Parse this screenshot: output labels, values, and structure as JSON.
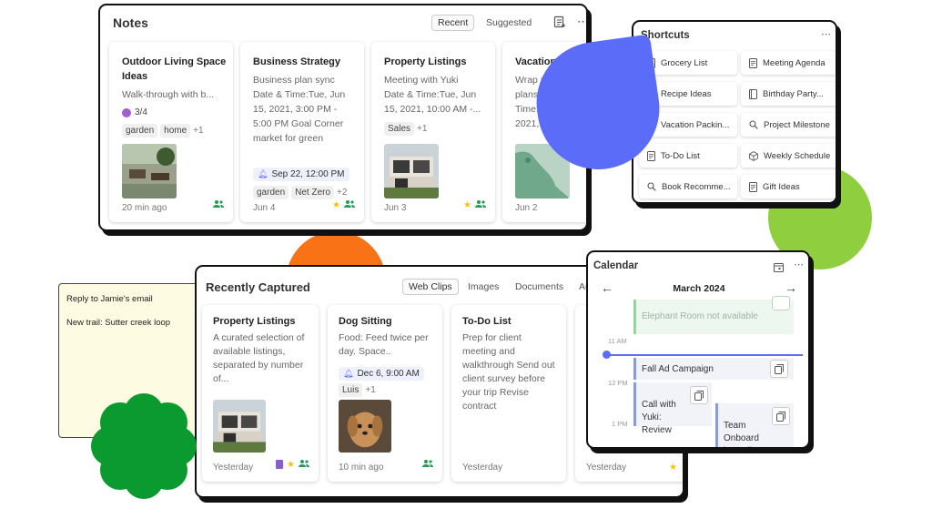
{
  "notes": {
    "title": "Notes",
    "tabs": [
      "Recent",
      "Suggested"
    ],
    "cards": [
      {
        "title": "Outdoor Living Space Ideas",
        "text": "Walk-through with b...",
        "checklist": "3/4",
        "tags": [
          "garden",
          "home"
        ],
        "more": "+1",
        "time": "20 min ago"
      },
      {
        "title": "Business Strategy",
        "text": "Business plan sync\nDate & Time:Tue, Jun\n15, 2021, 3:00 PM -\n5:00 PM Goal Corner\nmarket for green",
        "reminder": "Sep 22, 12:00 PM",
        "tags": [
          "garden",
          "Net Zero"
        ],
        "more": "+2",
        "time": "Jun 4"
      },
      {
        "title": "Property Listings",
        "text": "Meeting with Yuki\nDate & Time:Tue, Jun\n15, 2021, 10:00 AM -...",
        "tags": [
          "Sales"
        ],
        "more": "+1",
        "time": "Jun 3"
      },
      {
        "title": "Vacation Itinera",
        "text": "Wrap up vacati\nplans Date &\nTime:S\n2021,",
        "time": "Jun 2"
      }
    ]
  },
  "shortcuts": {
    "title": "Shortcuts",
    "items": [
      {
        "label": "Grocery List",
        "icon": "note-icon"
      },
      {
        "label": "Meeting Agenda",
        "icon": "note-icon"
      },
      {
        "label": "Recipe Ideas",
        "icon": "note-icon"
      },
      {
        "label": "Birthday Party...",
        "icon": "notebook-icon"
      },
      {
        "label": "Vacation Packin...",
        "icon": "note-icon"
      },
      {
        "label": "Project Milestone",
        "icon": "search-icon"
      },
      {
        "label": "To-Do List",
        "icon": "note-icon"
      },
      {
        "label": "Weekly Schedule",
        "icon": "cube-icon"
      },
      {
        "label": "Book Recomme...",
        "icon": "search-icon"
      },
      {
        "label": "Gift Ideas",
        "icon": "note-icon"
      }
    ]
  },
  "sticky": {
    "lines": [
      "Reply to Jamie's email",
      "New trail: Sutter creek loop"
    ]
  },
  "recent": {
    "title": "Recently Captured",
    "tabs": [
      "Web Clips",
      "Images",
      "Documents",
      "Au"
    ],
    "cards": [
      {
        "title": "Property Listings",
        "text": "A curated selection of\navailable listings,\nseparated by number\nof...",
        "time": "Yesterday"
      },
      {
        "title": "Dog Sitting",
        "text": "Food: Feed twice per\nday. Space..",
        "reminder": "Dec 6, 9:00 AM",
        "tags": [
          "Luis"
        ],
        "more": "+1",
        "time": "10 min ago"
      },
      {
        "title": "To-Do List",
        "text": "Prep for client\nmeeting and\nwalkthrough Send out\nclient survey before\nyour trip Revise\ncontract",
        "time": "Yesterday"
      },
      {
        "title": "",
        "text": "",
        "time": "Yesterday"
      }
    ]
  },
  "calendar": {
    "title": "Calendar",
    "month": "March 2024",
    "times": [
      "11 AM",
      "12 PM",
      "1 PM"
    ],
    "events": [
      {
        "label": "Elephant Room not available"
      },
      {
        "label": "Fall Ad Campaign"
      },
      {
        "label": "Call with\nYuki:\nReview"
      },
      {
        "label": "Team\nOnboard\ning call"
      }
    ]
  },
  "colors": {
    "accent_blue": "#5b6cf9",
    "orange": "#f97316",
    "green_light": "#8fce3e",
    "green_dark": "#0a9a2f",
    "sticky_bg": "#fdfbe2",
    "shared_green": "#1f9d55",
    "star_yellow": "#f5c400"
  }
}
